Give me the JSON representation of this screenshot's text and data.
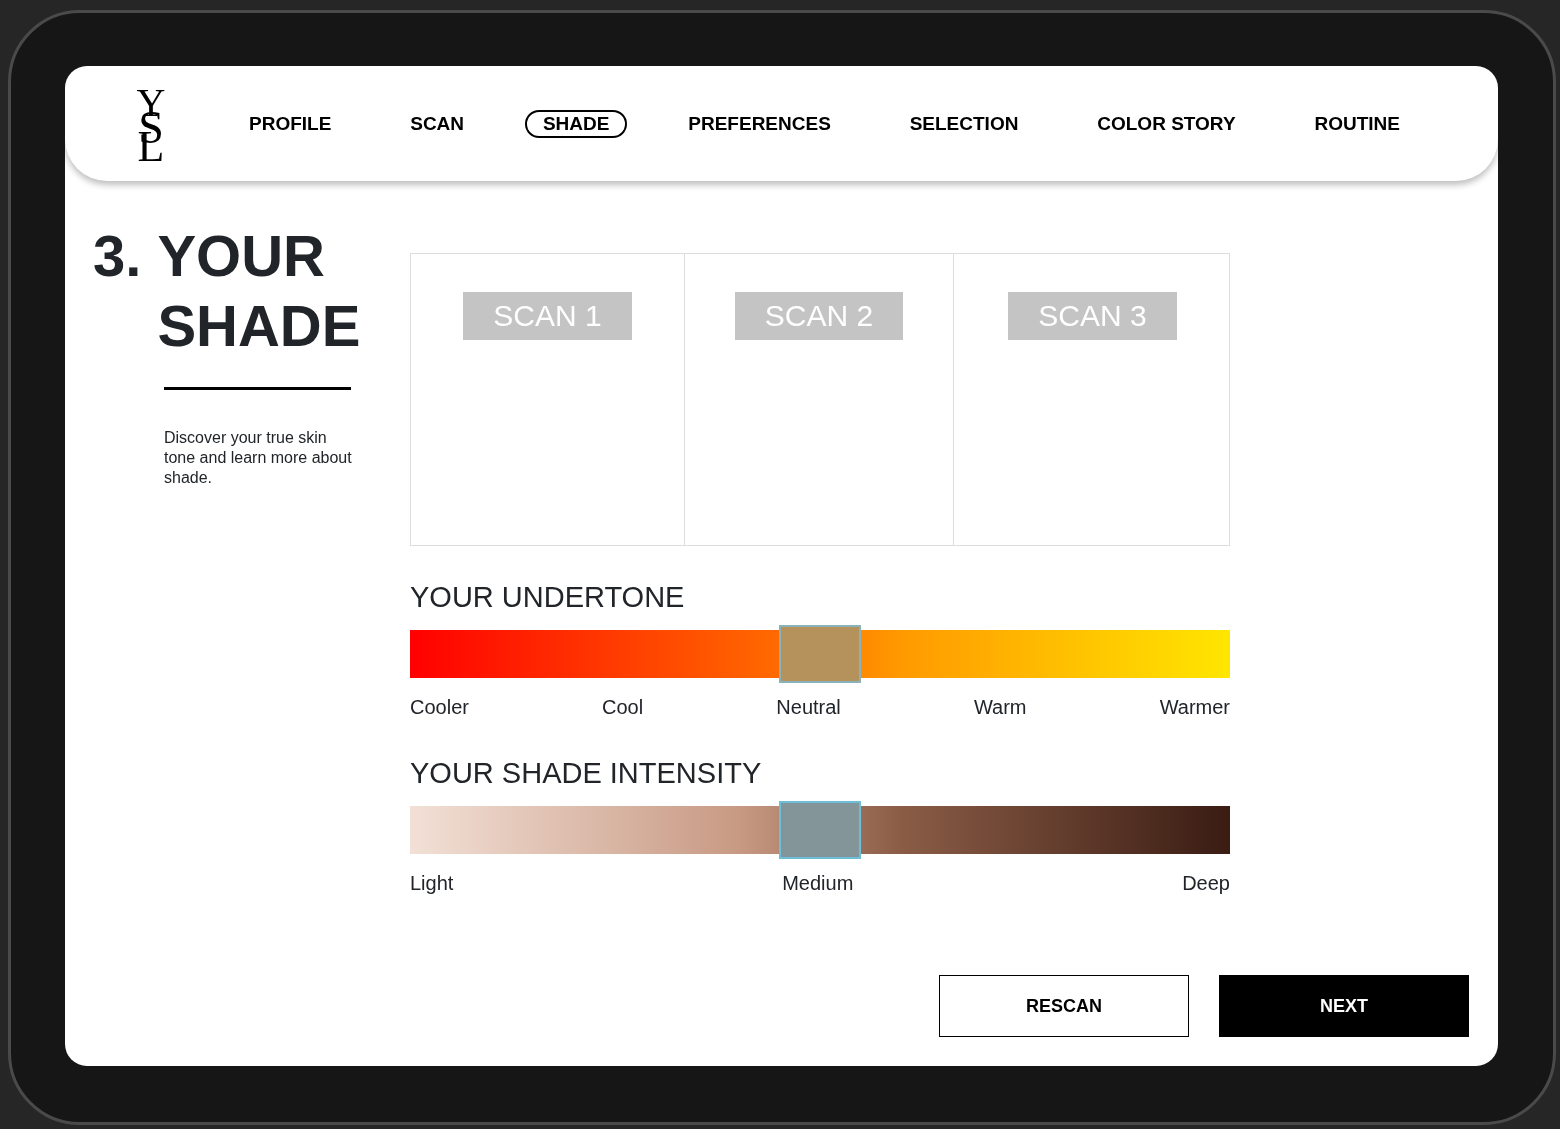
{
  "brand": {
    "logo": "YSL"
  },
  "nav": [
    {
      "label": "PROFILE",
      "selected": false
    },
    {
      "label": "SCAN",
      "selected": false
    },
    {
      "label": "SHADE",
      "selected": true
    },
    {
      "label": "PREFERENCES",
      "selected": false
    },
    {
      "label": "SELECTION",
      "selected": false
    },
    {
      "label": "COLOR STORY",
      "selected": false
    },
    {
      "label": "ROUTINE",
      "selected": false
    }
  ],
  "heading": {
    "step": "3.",
    "title": "YOUR SHADE",
    "description": "Discover your true skin tone and learn more about shade."
  },
  "scans": [
    {
      "label": "SCAN 1"
    },
    {
      "label": "SCAN 2"
    },
    {
      "label": "SCAN 3"
    }
  ],
  "scales": [
    {
      "kind": "undertone",
      "title": "YOUR UNDERTONE",
      "level": 0.5,
      "labels": [
        "Cooler",
        "Cool",
        "Neutral",
        "Warm",
        "Warmer"
      ]
    },
    {
      "kind": "intensity",
      "title": "YOUR SHADE INTENSITY",
      "level": 0.5,
      "labels": [
        "Light",
        "Medium",
        "Deep"
      ]
    }
  ],
  "buttons": [
    {
      "label": "RESCAN",
      "kind": "outline"
    },
    {
      "label": "NEXT",
      "kind": "primary"
    }
  ]
}
